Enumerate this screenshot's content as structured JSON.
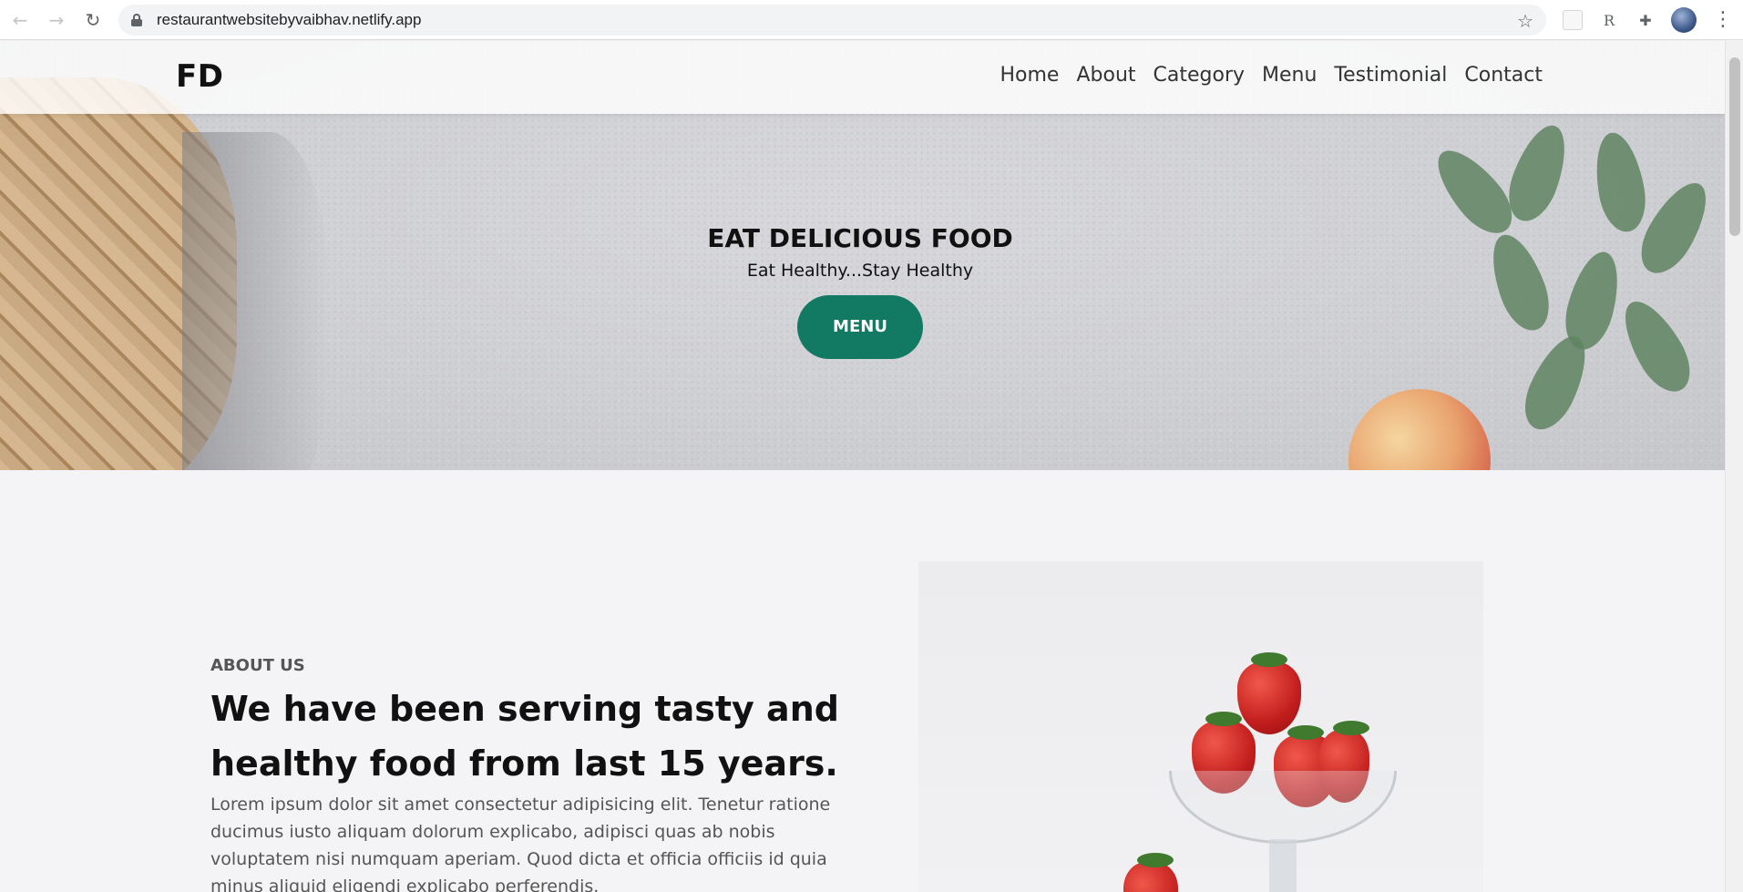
{
  "browser": {
    "url": "restaurantwebsitebyvaibhav.netlify.app",
    "back_icon": "arrow-left-icon",
    "forward_icon": "arrow-right-icon",
    "reload_icon": "reload-icon",
    "bookmark_icon": "star-icon",
    "extensions_icon": "puzzle-icon",
    "menu_icon": "kebab-menu-icon",
    "ext_badge_label": "R"
  },
  "site": {
    "brand": "FD",
    "nav": [
      "Home",
      "About",
      "Category",
      "Menu",
      "Testimonial",
      "Contact"
    ],
    "hero": {
      "title": "EAT DELICIOUS FOOD",
      "subtitle": "Eat Healthy...Stay Healthy",
      "button": "MENU",
      "button_color": "#127a62"
    },
    "about": {
      "kicker": "ABOUT US",
      "title": "We have been serving tasty and healthy food from last 15 years.",
      "text": "Lorem ipsum dolor sit amet consectetur adipisicing elit. Tenetur ratione ducimus iusto aliquam dolorum explicabo, adipisci quas ab nobis voluptatem nisi numquam aperiam. Quod dicta et officia officiis id quia minus aliquid eligendi explicabo perferendis."
    }
  }
}
